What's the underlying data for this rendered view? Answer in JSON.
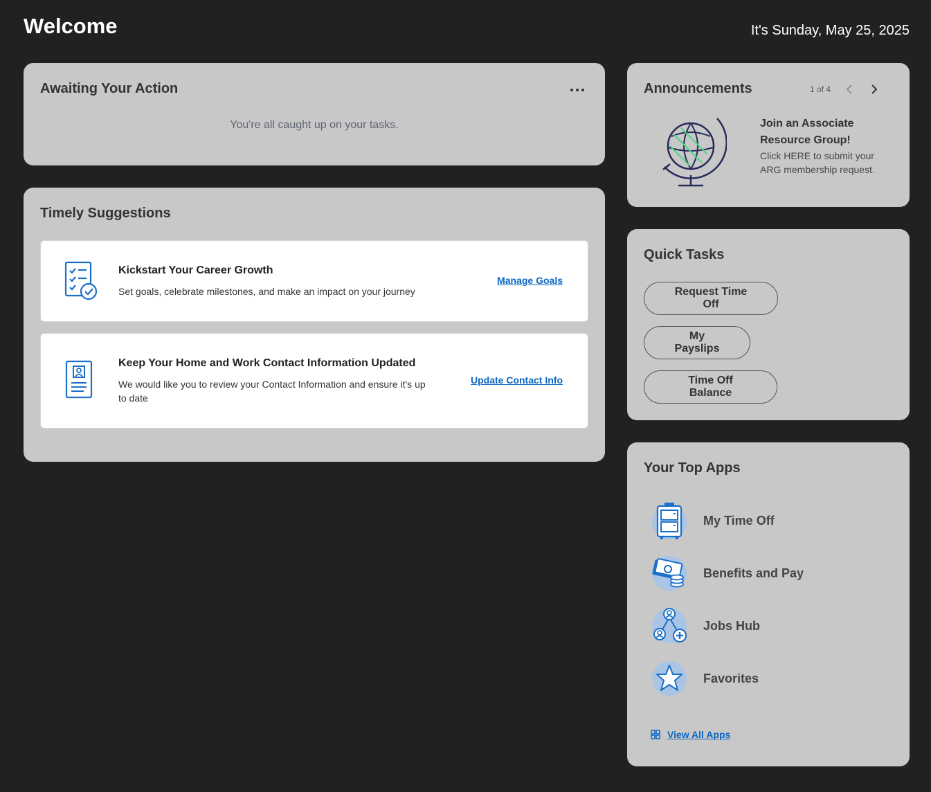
{
  "header": {
    "title": "Welcome",
    "date": "It's Sunday, May 25, 2025"
  },
  "awaiting": {
    "title": "Awaiting Your Action",
    "empty_message": "You're all caught up on your tasks."
  },
  "timely": {
    "title": "Timely Suggestions",
    "items": [
      {
        "icon": "checklist-icon",
        "title": "Kickstart Your Career Growth",
        "description": "Set goals, celebrate milestones, and make an impact on your journey",
        "link": "Manage Goals"
      },
      {
        "icon": "contact-card-icon",
        "title": "Keep Your Home and Work Contact Information Updated",
        "description": "We would like you to review your Contact Information and ensure it's up to date",
        "link": "Update Contact Info"
      }
    ]
  },
  "announcements": {
    "title": "Announcements",
    "pager": "1 of 4",
    "item": {
      "icon": "globe-icon",
      "title": "Join an Associate Resource Group!",
      "body": "Click HERE to submit your ARG membership request."
    }
  },
  "quick_tasks": {
    "title": "Quick Tasks",
    "items": [
      "Request Time Off",
      "My Payslips",
      "Time Off Balance"
    ]
  },
  "top_apps": {
    "title": "Your Top Apps",
    "items": [
      {
        "label": "My Time Off",
        "icon": "luggage-icon"
      },
      {
        "label": "Benefits and Pay",
        "icon": "money-icon"
      },
      {
        "label": "Jobs Hub",
        "icon": "people-network-icon"
      },
      {
        "label": "Favorites",
        "icon": "star-icon"
      }
    ],
    "view_all": "View All Apps"
  },
  "colors": {
    "background": "#212121",
    "card": "#c8c8c8",
    "link": "#0b66c3",
    "icon_blue": "#1a6fc9"
  }
}
